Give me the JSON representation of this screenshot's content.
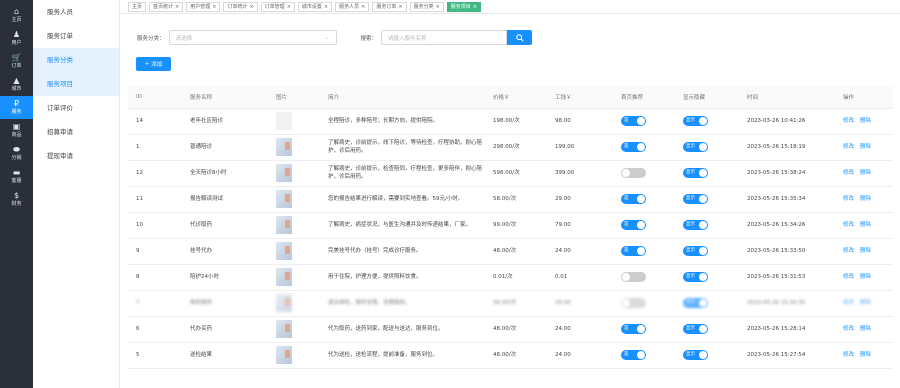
{
  "rail": [
    {
      "icon": "⌂",
      "label": "主页",
      "name": "home"
    },
    {
      "icon": "♟",
      "label": "用户",
      "name": "user"
    },
    {
      "icon": "🛒",
      "label": "订单",
      "name": "order"
    },
    {
      "icon": "▲",
      "label": "城市",
      "name": "city"
    },
    {
      "icon": "₽",
      "label": "服务",
      "name": "service",
      "active": true
    },
    {
      "icon": "▣",
      "label": "商品",
      "name": "goods"
    },
    {
      "icon": "⬬",
      "label": "分销",
      "name": "distribution"
    },
    {
      "icon": "▬",
      "label": "客服",
      "name": "support"
    },
    {
      "icon": "$",
      "label": "财务",
      "name": "finance"
    }
  ],
  "submenu": [
    {
      "label": "服务人员"
    },
    {
      "label": "服务订单"
    },
    {
      "label": "服务分类",
      "active": true
    },
    {
      "label": "服务项目",
      "active": true
    },
    {
      "label": "订单评价"
    },
    {
      "label": "招募审请"
    },
    {
      "label": "提现审请"
    }
  ],
  "tabs": [
    {
      "label": "主页"
    },
    {
      "label": "首页统计"
    },
    {
      "label": "用户管理"
    },
    {
      "label": "订单统计"
    },
    {
      "label": "订单管理"
    },
    {
      "label": "城市设置"
    },
    {
      "label": "服务人员"
    },
    {
      "label": "服务订单"
    },
    {
      "label": "服务分类"
    },
    {
      "label": "服务项目",
      "active": true
    }
  ],
  "filters": {
    "category_label": "服务分类：",
    "category_placeholder": "请选择",
    "search_label": "搜索：",
    "search_placeholder": "请输入服务名称"
  },
  "add_button": "添加",
  "table": {
    "headers": [
      "ID",
      "服务名称",
      "图片",
      "简介",
      "价格￥",
      "工钱￥",
      "首页推荐",
      "显示隐藏",
      "时间",
      "操作"
    ],
    "rows": [
      {
        "id": "14",
        "name": "老年社区陪诊",
        "desc": "全程陪诊，多种陪号；长期方向，提供陪院。",
        "price": "198.00/次",
        "wage": "98.00",
        "rec": "是",
        "rec_on": true,
        "show": "显示",
        "show_on": true,
        "time": "2023-03-26 10:41:26",
        "blank": true
      },
      {
        "id": "1",
        "name": "普通陪诊",
        "desc": "了解病史，诊前提示，线下陪诊，等待检查，疗程协助，耐心陪护，诊后用药。",
        "price": "298.00/次",
        "wage": "199.00",
        "rec": "是",
        "rec_on": true,
        "show": "显示",
        "show_on": true,
        "time": "2023-05-26 15:18:19"
      },
      {
        "id": "12",
        "name": "全天陪诊8小时",
        "desc": "了解病史，诊前提示，检查陪同，疗程检查，更多陪伴，耐心陪护，诊后用药。",
        "price": "598.00/次",
        "wage": "399.00",
        "rec": "",
        "rec_on": false,
        "show": "显示",
        "show_on": true,
        "time": "2023-05-26 15:38:24"
      },
      {
        "id": "11",
        "name": "报告解读测试",
        "desc": "您的报告结果进行解读，需要到实地查看。59元/小时。",
        "price": "58.00/次",
        "wage": "29.00",
        "rec": "是",
        "rec_on": true,
        "show": "显示",
        "show_on": true,
        "time": "2023-05-26 15:35:34"
      },
      {
        "id": "10",
        "name": "代诊取药",
        "desc": "了解病史，病症状况，与医生沟通并及时传递结果，厂家。",
        "price": "99.00/次",
        "wage": "79.00",
        "rec": "是",
        "rec_on": true,
        "show": "显示",
        "show_on": true,
        "time": "2023-05-26 15:34:26"
      },
      {
        "id": "9",
        "name": "挂号代办",
        "desc": "完美挂号代办（挂号）完成诊疗服务。",
        "price": "48.00/次",
        "wage": "24.00",
        "rec": "是",
        "rec_on": true,
        "show": "显示",
        "show_on": true,
        "time": "2023-05-26 15:33:50"
      },
      {
        "id": "8",
        "name": "陪护24小时",
        "desc": "用于住院，护理方便，提供照料饮食。",
        "price": "0.01/次",
        "wage": "0.01",
        "rec": "",
        "rec_on": false,
        "show": "显示",
        "show_on": true,
        "time": "2023-05-26 15:31:53"
      },
      {
        "id": "7",
        "name": "体检陪伴",
        "desc": "适合体检，陪伴全程，全程陪同。",
        "price": "58.00/次",
        "wage": "29.00",
        "rec": "",
        "rec_on": false,
        "show": "显示",
        "show_on": true,
        "time": "2023-05-26 15:30:35",
        "blurred": true
      },
      {
        "id": "6",
        "name": "代办买药",
        "desc": "代为取药，送药到家，配送与送达，服务到位。",
        "price": "48.00/次",
        "wage": "24.00",
        "rec": "是",
        "rec_on": true,
        "show": "显示",
        "show_on": true,
        "time": "2023-05-26 15:28:14"
      },
      {
        "id": "5",
        "name": "送检结果",
        "desc": "代为送检，送检流程，提前准备，服务到位。",
        "price": "48.00/次",
        "wage": "24.00",
        "rec": "是",
        "rec_on": true,
        "show": "显示",
        "show_on": true,
        "time": "2023-05-26 15:27:54"
      }
    ],
    "op_edit": "修改",
    "op_delete": "删除"
  }
}
